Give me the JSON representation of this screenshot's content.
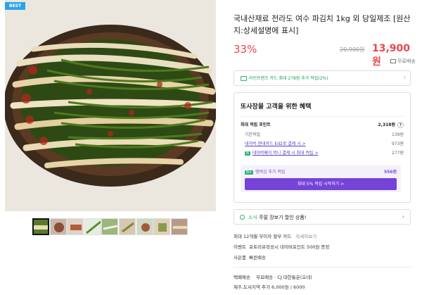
{
  "product": {
    "badge": "BEST",
    "title": "국내산재료 전라도 여수 파김치 1kg 외 당일제조 [원산지:상세설명에 표시]",
    "discount": "33%",
    "original_price": "20,900원",
    "price": "13,900원",
    "shipping_label": "무료배송"
  },
  "card_promo": {
    "text": "라인프렌즈 카드 최대 278원 추가 적립(2%)",
    "chevron": "›"
  },
  "benefits": {
    "title": "또사장몰 고객을 위한 혜택",
    "max_points_label": "최대 적립 포인트",
    "max_points_value": "2,318원",
    "help": "?",
    "rows": [
      {
        "label": "기본적립",
        "value": "139원"
      },
      {
        "label": "네이버 현대카드 Ed2로 결제 시 >",
        "value": "973원"
      },
      {
        "label": "네이버페이 머니 결제 시 최대 적립 >",
        "value": "277원"
      }
    ],
    "tag_money": "N",
    "membership_tag": "N+",
    "membership_label": "멤버십 추가 적립",
    "membership_value": "556원",
    "membership_button": "최대 5% 적립 시작하기 >"
  },
  "coupon": {
    "prefix": "소식",
    "text": "주말 장보기 할인 상품!",
    "chevron": "›"
  },
  "info": {
    "installment": "최대 12개월 무이자 할부 카드",
    "installment_link": "자세히보기",
    "event_label": "이벤트",
    "event_text": "포토리뷰작성시 네이버포인트 500원 증정",
    "gift_label": "사은품",
    "gift_text": "빠른배송",
    "delivery_label": "택배배송",
    "delivery_text": "무료배송 · CJ 대한통운(오네)",
    "delivery_extra": "제주,도서지역 추가 6,000원 / 6000"
  },
  "colors": {
    "accent": "#e8474b",
    "green": "#2bb673",
    "purple": "#7543d8"
  }
}
